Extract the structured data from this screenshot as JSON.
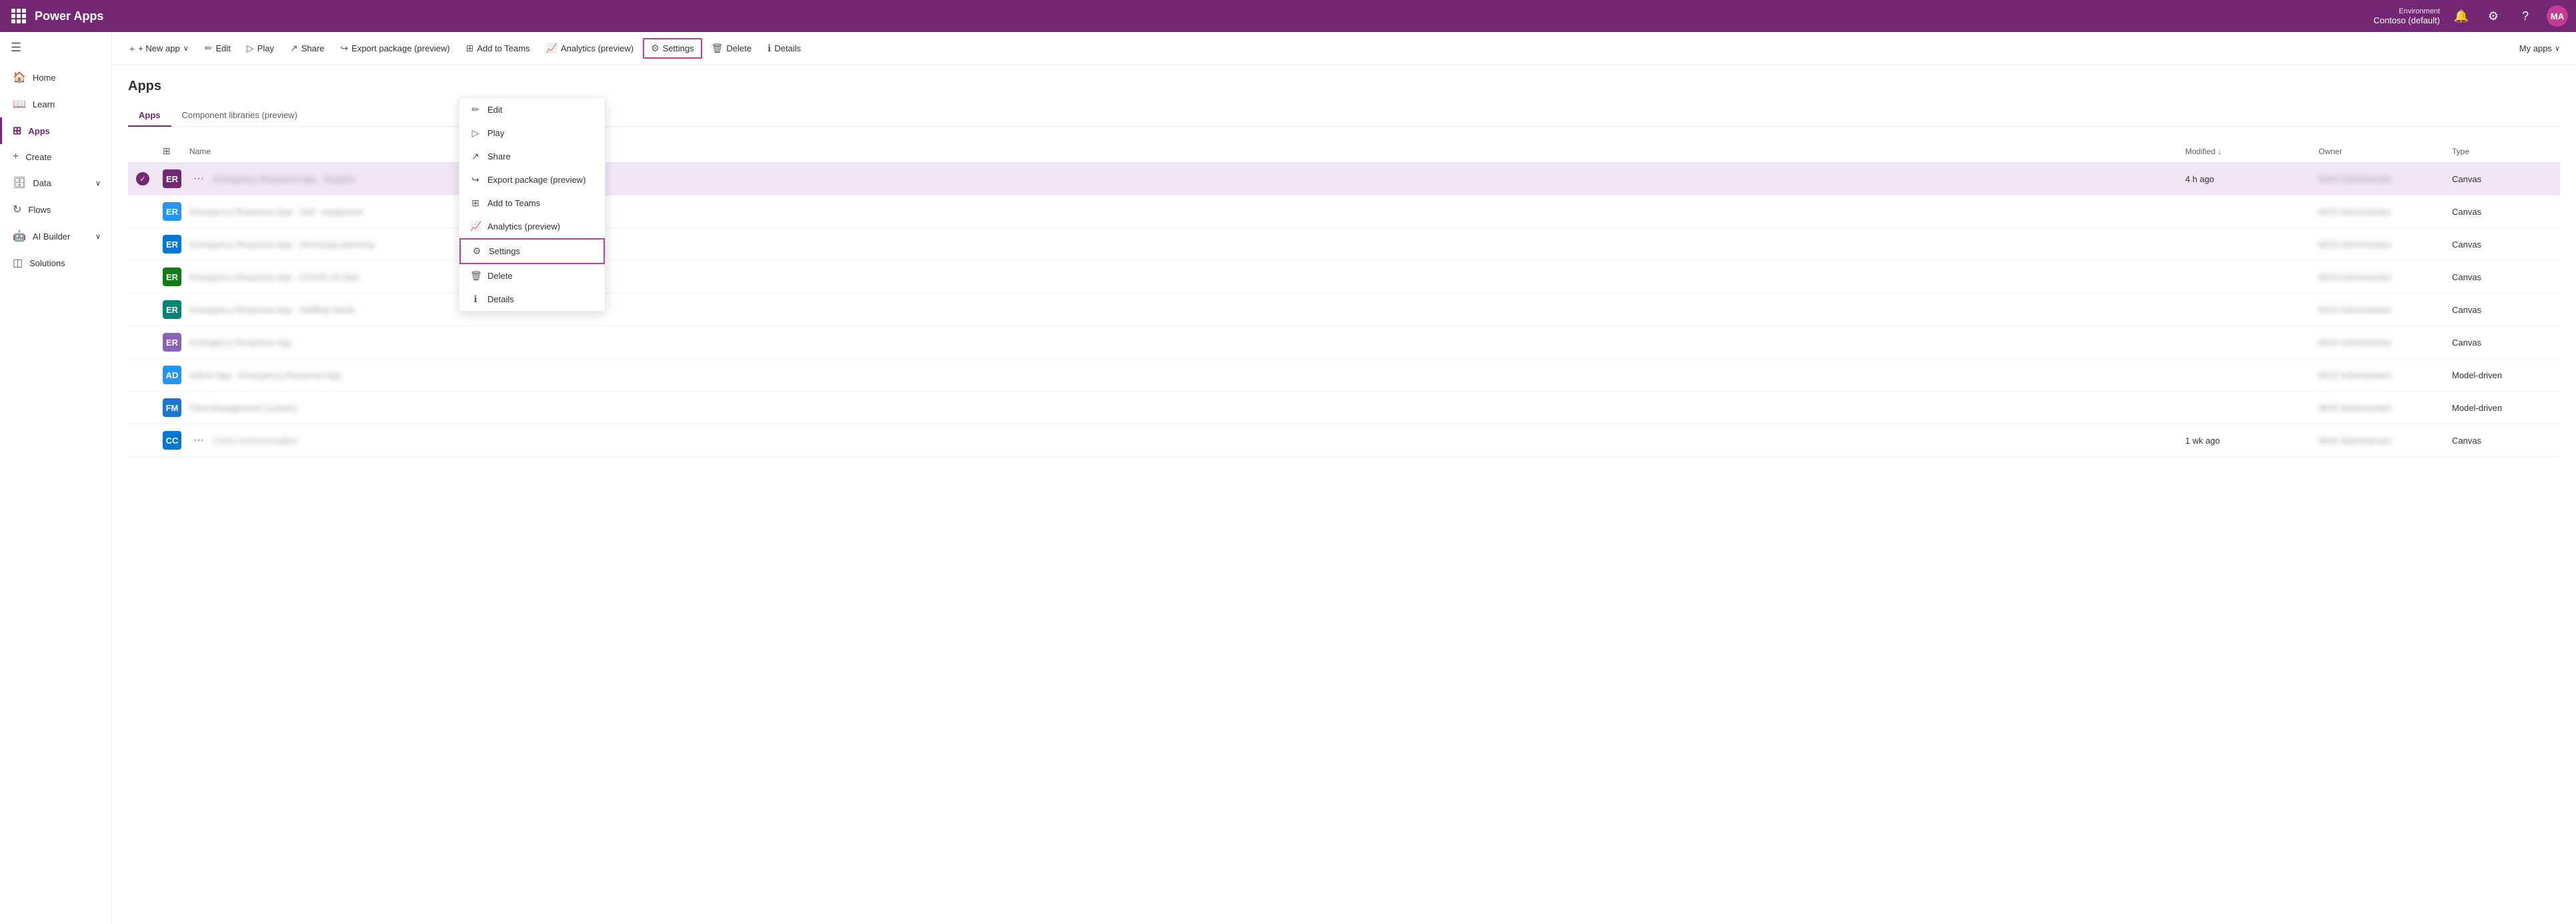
{
  "topnav": {
    "app_title": "Power Apps",
    "environment_label": "Environment",
    "environment_name": "Contoso (default)",
    "avatar_initials": "MA"
  },
  "toolbar": {
    "new_app": "+ New app",
    "edit": "Edit",
    "play": "Play",
    "share": "Share",
    "export_package": "Export package (preview)",
    "add_to_teams": "Add to Teams",
    "analytics": "Analytics (preview)",
    "settings": "Settings",
    "delete": "Delete",
    "details": "Details",
    "my_apps": "My apps"
  },
  "sidebar": {
    "collapse_label": "Collapse",
    "items": [
      {
        "id": "home",
        "label": "Home",
        "icon": "🏠"
      },
      {
        "id": "learn",
        "label": "Learn",
        "icon": "📖"
      },
      {
        "id": "apps",
        "label": "Apps",
        "icon": "⊞",
        "active": true
      },
      {
        "id": "create",
        "label": "Create",
        "icon": "+"
      },
      {
        "id": "data",
        "label": "Data",
        "icon": "🗄",
        "hasChevron": true
      },
      {
        "id": "flows",
        "label": "Flows",
        "icon": "↻"
      },
      {
        "id": "ai_builder",
        "label": "AI Builder",
        "icon": "🤖",
        "hasChevron": true
      },
      {
        "id": "solutions",
        "label": "Solutions",
        "icon": "◫"
      }
    ]
  },
  "main": {
    "page_title": "Apps",
    "tabs": [
      {
        "id": "apps",
        "label": "Apps",
        "active": true
      },
      {
        "id": "component_libraries",
        "label": "Component libraries (preview)",
        "active": false
      }
    ],
    "table": {
      "columns": [
        "",
        "",
        "Name",
        "Modified ↓",
        "Owner",
        "Type"
      ],
      "rows": [
        {
          "id": 1,
          "selected": true,
          "icon_bg": "#742774",
          "icon_text": "ER",
          "name": "Emergency Response App - Supplier",
          "modified": "4 h ago",
          "owner": "MOD Administrator",
          "type": "Canvas",
          "has_more": true
        },
        {
          "id": 2,
          "selected": false,
          "icon_bg": "#2196F3",
          "icon_text": "ER",
          "name": "Emergency Response App - Self - equipment",
          "modified": "",
          "owner": "MOD Administrator",
          "type": "Canvas",
          "has_more": false
        },
        {
          "id": 3,
          "selected": false,
          "icon_bg": "#0078d4",
          "icon_text": "ER",
          "name": "Emergency Response App - Discharge planning",
          "modified": "",
          "owner": "MOD Administrator",
          "type": "Canvas",
          "has_more": false
        },
        {
          "id": 4,
          "selected": false,
          "icon_bg": "#107C10",
          "icon_text": "ER",
          "name": "Emergency Response App - COVID-19 data",
          "modified": "",
          "owner": "MOD Administrator",
          "type": "Canvas",
          "has_more": false
        },
        {
          "id": 5,
          "selected": false,
          "icon_bg": "#008575",
          "icon_text": "ER",
          "name": "Emergency Response App - Staffing needs",
          "modified": "",
          "owner": "MOD Administrator",
          "type": "Canvas",
          "has_more": false
        },
        {
          "id": 6,
          "selected": false,
          "icon_bg": "#8764B8",
          "icon_text": "ER",
          "name": "Emergency Response App",
          "modified": "",
          "owner": "MOD Administrator",
          "type": "Canvas",
          "has_more": false
        },
        {
          "id": 7,
          "selected": false,
          "icon_bg": "#2196F3",
          "icon_text": "AD",
          "name": "Admin App - Emergency Response App",
          "modified": "",
          "owner": "MOD Administrator",
          "type": "Model-driven",
          "has_more": false
        },
        {
          "id": 8,
          "selected": false,
          "icon_bg": "#1976D2",
          "icon_text": "FM",
          "name": "Field Management (custom)",
          "modified": "",
          "owner": "MOD Administrator",
          "type": "Model-driven",
          "has_more": false
        },
        {
          "id": 9,
          "selected": false,
          "icon_bg": "#0078d4",
          "icon_text": "CC",
          "name": "Crisis Communication",
          "modified": "1 wk ago",
          "owner": "MOD Administrator",
          "type": "Canvas",
          "has_more": true
        }
      ]
    }
  },
  "context_menu": {
    "visible": true,
    "items": [
      {
        "id": "edit",
        "label": "Edit",
        "icon": "✏"
      },
      {
        "id": "play",
        "label": "Play",
        "icon": "▷"
      },
      {
        "id": "share",
        "label": "Share",
        "icon": "↗"
      },
      {
        "id": "export_package",
        "label": "Export package (preview)",
        "icon": "↪"
      },
      {
        "id": "add_to_teams",
        "label": "Add to Teams",
        "icon": "⊞"
      },
      {
        "id": "analytics",
        "label": "Analytics (preview)",
        "icon": "📈"
      },
      {
        "id": "settings",
        "label": "Settings",
        "icon": "⚙",
        "highlighted": true
      },
      {
        "id": "delete",
        "label": "Delete",
        "icon": "🗑"
      },
      {
        "id": "details",
        "label": "Details",
        "icon": "ℹ"
      }
    ]
  }
}
